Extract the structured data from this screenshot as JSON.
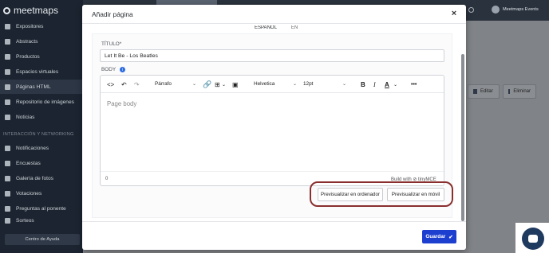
{
  "app": {
    "logo_text": "meetmaps",
    "sidebar": {
      "items": [
        {
          "label": "Expositores"
        },
        {
          "label": "Abstracts"
        },
        {
          "label": "Productos"
        },
        {
          "label": "Espacios virtuales"
        },
        {
          "label": "Páginas HTML"
        },
        {
          "label": "Repositorio de imágenes"
        },
        {
          "label": "Noticias"
        },
        {
          "label": "Notificaciones"
        },
        {
          "label": "Encuestas"
        },
        {
          "label": "Galería de fotos"
        },
        {
          "label": "Votaciones"
        },
        {
          "label": "Preguntas al ponente"
        },
        {
          "label": "Sorteos"
        }
      ],
      "section_label": "INTERACCIÓN Y NETWORKING",
      "help_button": "Centro de Ayuda"
    },
    "topbar": {
      "user_name": "Meetmaps Events"
    },
    "background_buttons": {
      "edit": "Editar",
      "delete": "Eliminar"
    }
  },
  "modal": {
    "title": "Añadir página",
    "close_symbol": "×",
    "language_tabs": [
      "ESPAÑOL",
      "EN"
    ],
    "title_field": {
      "label": "TÍTULO*",
      "value": "Let It Be - Los Beatles"
    },
    "body_field": {
      "label": "BODY",
      "info_symbol": "i"
    },
    "editor": {
      "toolbar": {
        "code": "<>",
        "undo": "↶",
        "redo": "↷",
        "block_format": "Párrafo",
        "font_family": "Helvetica",
        "font_size": "12pt",
        "bold": "B",
        "italic": "I",
        "text_color": "A",
        "more": "•••"
      },
      "placeholder": "Page body",
      "status_path": "0",
      "branding": "Build with ⊘ tinyMCE"
    },
    "preview_buttons": {
      "desktop": "Previsualizar en ordenador",
      "mobile": "Previsualizar en móvil"
    },
    "save_button": "Guardar"
  }
}
